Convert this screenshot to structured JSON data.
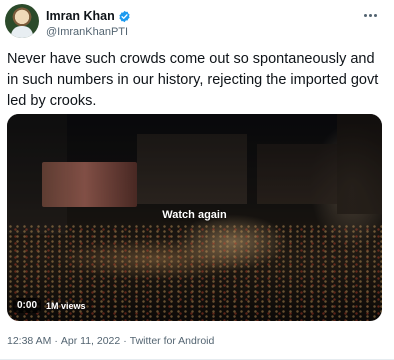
{
  "author": {
    "display_name": "Imran Khan",
    "handle": "@ImranKhanPTI",
    "verified": true,
    "avatar_icon": "avatar"
  },
  "tweet": {
    "text": "Never have such crowds come out so spontaneously and in such numbers in our history, rejecting the imported govt led by crooks."
  },
  "media": {
    "overlay_label": "Watch again",
    "duration": "0:00",
    "views": "1M views"
  },
  "footer": {
    "time": "12:38 AM",
    "separator": "·",
    "date": "Apr 11, 2022",
    "source": "Twitter for Android"
  },
  "colors": {
    "verified_blue": "#1d9bf0",
    "secondary_text": "#536471",
    "primary_text": "#0f1419"
  },
  "icons": {
    "verified": "verified-badge-icon",
    "more": "more-options-icon"
  }
}
